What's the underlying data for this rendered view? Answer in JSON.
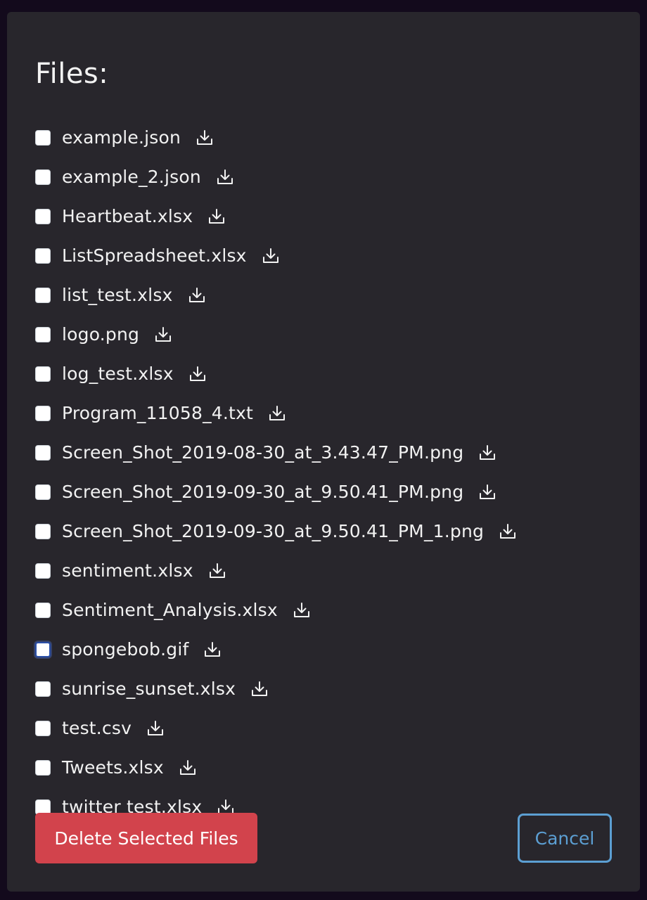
{
  "dialog": {
    "title": "Files:",
    "files": [
      {
        "name": "example.json",
        "checked": false
      },
      {
        "name": "example_2.json",
        "checked": false
      },
      {
        "name": "Heartbeat.xlsx",
        "checked": false
      },
      {
        "name": "ListSpreadsheet.xlsx",
        "checked": false
      },
      {
        "name": "list_test.xlsx",
        "checked": false
      },
      {
        "name": "logo.png",
        "checked": false
      },
      {
        "name": "log_test.xlsx",
        "checked": false
      },
      {
        "name": "Program_11058_4.txt",
        "checked": false
      },
      {
        "name": "Screen_Shot_2019-08-30_at_3.43.47_PM.png",
        "checked": false
      },
      {
        "name": "Screen_Shot_2019-09-30_at_9.50.41_PM.png",
        "checked": false
      },
      {
        "name": "Screen_Shot_2019-09-30_at_9.50.41_PM_1.png",
        "checked": false
      },
      {
        "name": "sentiment.xlsx",
        "checked": false
      },
      {
        "name": "Sentiment_Analysis.xlsx",
        "checked": false
      },
      {
        "name": "spongebob.gif",
        "checked": false,
        "focused": true
      },
      {
        "name": "sunrise_sunset.xlsx",
        "checked": false
      },
      {
        "name": "test.csv",
        "checked": false
      },
      {
        "name": "Tweets.xlsx",
        "checked": false
      },
      {
        "name": "twitter test.xlsx",
        "checked": false
      }
    ],
    "row_icon": "download-icon",
    "delete_label": "Delete Selected Files",
    "cancel_label": "Cancel"
  },
  "colors": {
    "background": "#130a1c",
    "dialog_bg": "#28262c",
    "text": "#f2f2f2",
    "danger": "#d2434c",
    "cancel_outline": "#5c9fd3",
    "focus_ring": "#2a4fa8"
  }
}
